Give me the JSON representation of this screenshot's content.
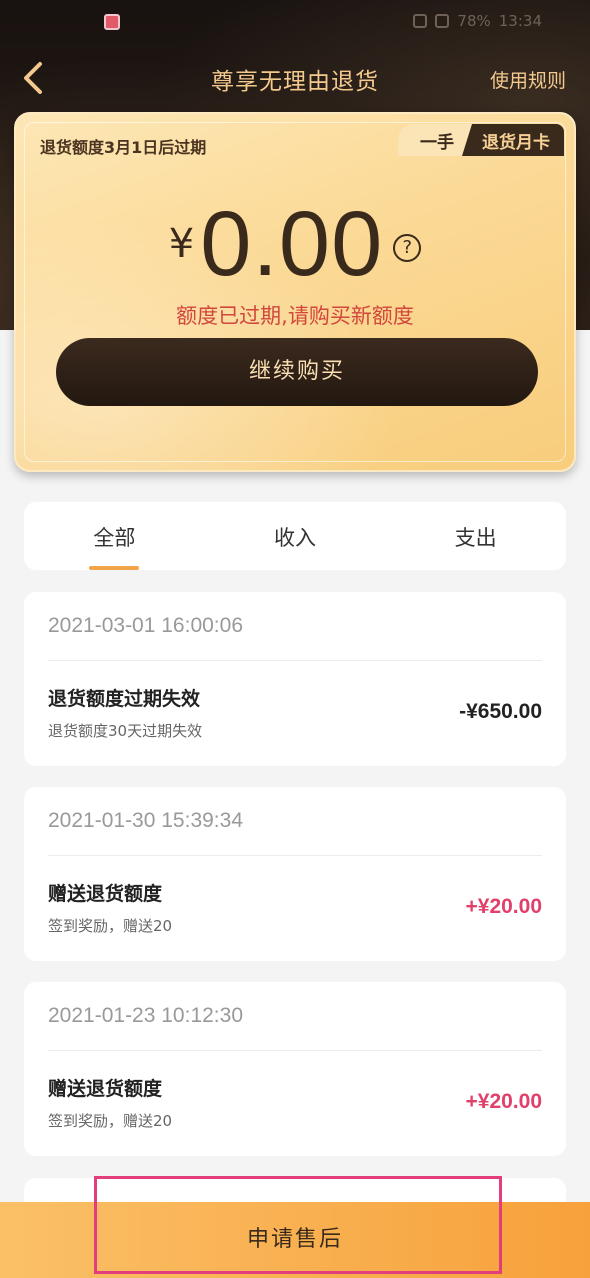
{
  "status_bar": {
    "battery": "78%",
    "time": "13:34"
  },
  "nav": {
    "title": "尊享无理由退货",
    "rules_link": "使用规则"
  },
  "card": {
    "expiry_note": "退货额度3月1日后过期",
    "badge_owner": "一手",
    "badge_card": "退货月卡",
    "currency": "¥",
    "amount": "0.00",
    "help": "?",
    "status_message": "额度已过期,请购买新额度",
    "buy_button": "继续购买"
  },
  "tabs": [
    {
      "label": "全部",
      "active": true
    },
    {
      "label": "收入",
      "active": false
    },
    {
      "label": "支出",
      "active": false
    }
  ],
  "records": [
    {
      "time": "2021-03-01 16:00:06",
      "title": "退货额度过期失效",
      "desc": "退货额度30天过期失效",
      "amount": "-¥650.00",
      "amount_color": "#222222"
    },
    {
      "time": "2021-01-30 15:39:34",
      "title": "赠送退货额度",
      "desc": "签到奖励，赠送20",
      "amount": "+¥20.00",
      "amount_color": "#e0406a"
    },
    {
      "time": "2021-01-23 10:12:30",
      "title": "赠送退货额度",
      "desc": "签到奖励，赠送20",
      "amount": "+¥20.00",
      "amount_color": "#e0406a"
    }
  ],
  "bottom_bar": {
    "label": "申请售后"
  },
  "colors": {
    "gold_text": "#f3c98e",
    "accent_orange": "#f7a13b",
    "negative": "#222222",
    "positive": "#e0406a",
    "highlight": "#e23d7d"
  }
}
